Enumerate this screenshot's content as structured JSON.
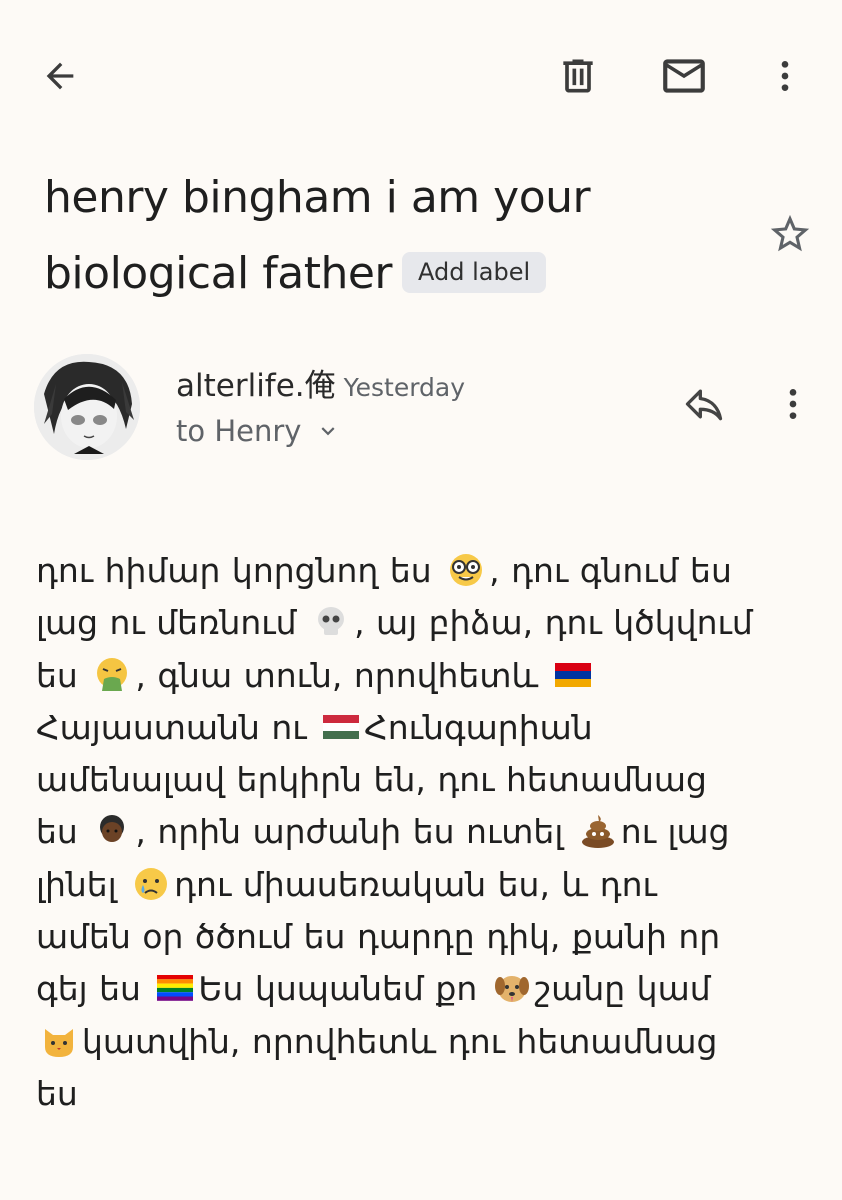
{
  "toolbar": {
    "back_icon": "arrow-back-icon",
    "delete_icon": "trash-icon",
    "mark_unread_icon": "mail-icon",
    "more_icon": "more-vertical-icon"
  },
  "email": {
    "subject_line1": "henry bingham i am your",
    "subject_line2": "biological father",
    "add_label": "Add label",
    "star_icon": "star-outline-icon"
  },
  "sender": {
    "name": "alterlife.俺",
    "time": "Yesterday",
    "to": "to Henry",
    "reply_icon": "reply-icon",
    "more_icon": "more-vertical-icon",
    "expand_icon": "chevron-down-icon"
  },
  "body": {
    "lines": [
      "դու հիմար կորցնող ես",
      ", դու գնում ես",
      "լաց ու մեռնում",
      ", այ բիձա, դու կծկվում",
      "ես",
      ", գնա տուն, որովհետև",
      "Հայաստանն ու",
      "Հունգարիան",
      "ամենալավ երկիրն են, դու հետամնաց",
      "ես",
      ", որին արժանի ես ուտել",
      "ու լաց",
      "լինել",
      "դու միասեռական ես, և դու",
      "ամեն օր ծծում ես դարդը դիկ, քանի որ",
      "գեյ ես",
      "Ես կսպանեմ քո",
      "շանը կամ",
      "կատվին, որովհետև դու հետամնաց",
      "ես"
    ]
  },
  "colors": {
    "background": "#fdfaf6",
    "text": "#1f1f1f",
    "muted": "#5f6368",
    "chip": "#e7e8ec"
  }
}
